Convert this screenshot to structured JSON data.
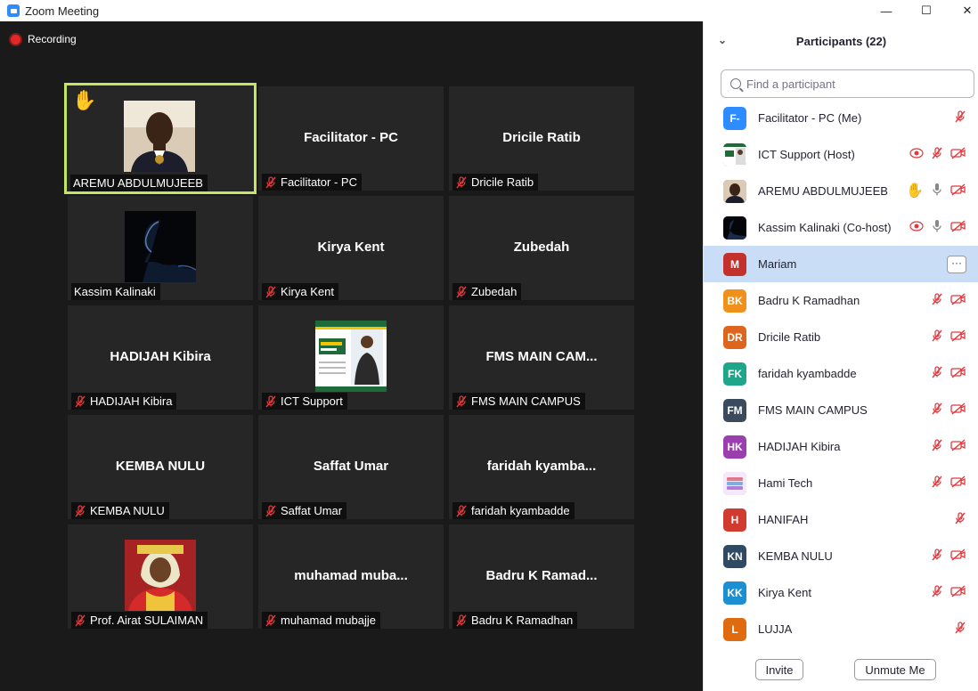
{
  "window": {
    "title": "Zoom Meeting",
    "minimize": "—",
    "maximize": "☐",
    "close": "✕"
  },
  "recording": {
    "label": "Recording"
  },
  "tiles": [
    {
      "name": "AREMU ABDULMUJEEB",
      "center": "",
      "muted": false,
      "photo": "portrait-man-suit",
      "hand": true,
      "active": true
    },
    {
      "name": "Facilitator - PC",
      "center": "Facilitator - PC",
      "muted": true
    },
    {
      "name": "Dricile Ratib",
      "center": "Dricile Ratib",
      "muted": true
    },
    {
      "name": "Kassim Kalinaki",
      "center": "",
      "muted": false,
      "photo": "silhouette-dark"
    },
    {
      "name": "Kirya Kent",
      "center": "Kirya Kent",
      "muted": true
    },
    {
      "name": "Zubedah",
      "center": "Zubedah",
      "muted": true
    },
    {
      "name": "HADIJAH Kibira",
      "center": "HADIJAH Kibira",
      "muted": true
    },
    {
      "name": "ICT Support",
      "center": "",
      "muted": true,
      "photo": "admissions-poster"
    },
    {
      "name": "FMS MAIN CAMPUS",
      "center": "FMS MAIN CAM...",
      "muted": true
    },
    {
      "name": "KEMBA NULU",
      "center": "KEMBA NULU",
      "muted": true
    },
    {
      "name": "Saffat Umar",
      "center": "Saffat Umar",
      "muted": true
    },
    {
      "name": "faridah kyambadde",
      "center": "faridah  kyamba...",
      "muted": true
    },
    {
      "name": "Prof. Airat SULAIMAN",
      "center": "",
      "muted": true,
      "photo": "portrait-academic-red"
    },
    {
      "name": "muhamad mubajje",
      "center": "muhamad  muba...",
      "muted": true
    },
    {
      "name": "Badru K Ramadhan",
      "center": "Badru  K  Ramad...",
      "muted": true
    }
  ],
  "panel": {
    "title": "Participants (22)",
    "search_placeholder": "Find a participant",
    "participants": [
      {
        "initials": "F-",
        "name": "Facilitator - PC (Me)",
        "color": "#2d8cff",
        "icons": [
          "mic-muted-icon"
        ]
      },
      {
        "initials": "",
        "name": "ICT Support (Host)",
        "color": "#3a7d3a",
        "image": "poster-thumb",
        "icons": [
          "recording-icon",
          "mic-muted-icon",
          "video-off-icon"
        ]
      },
      {
        "initials": "",
        "name": "AREMU ABDULMUJEEB",
        "color": "#555555",
        "image": "face-thumb",
        "icons": [
          "raised-hand-icon",
          "mic-on-icon",
          "video-off-icon"
        ]
      },
      {
        "initials": "",
        "name": "Kassim Kalinaki (Co-host)",
        "color": "#111111",
        "image": "silhouette-thumb",
        "icons": [
          "recording-icon",
          "mic-on-icon",
          "video-off-icon"
        ]
      },
      {
        "initials": "M",
        "name": "Mariam",
        "color": "#c4302b",
        "selected": true,
        "icons": [
          "more-button"
        ]
      },
      {
        "initials": "BK",
        "name": "Badru K Ramadhan",
        "color": "#f0911c",
        "icons": [
          "mic-muted-icon",
          "video-off-icon"
        ]
      },
      {
        "initials": "DR",
        "name": "Dricile Ratib",
        "color": "#e0651c",
        "icons": [
          "mic-muted-icon",
          "video-off-icon"
        ]
      },
      {
        "initials": "FK",
        "name": "faridah kyambadde",
        "color": "#1fa58a",
        "icons": [
          "mic-muted-icon",
          "video-off-icon"
        ]
      },
      {
        "initials": "FM",
        "name": "FMS MAIN CAMPUS",
        "color": "#3b4a5c",
        "icons": [
          "mic-muted-icon",
          "video-off-icon"
        ]
      },
      {
        "initials": "HK",
        "name": "HADIJAH Kibira",
        "color": "#9b3fb0",
        "icons": [
          "mic-muted-icon",
          "video-off-icon"
        ]
      },
      {
        "initials": "",
        "name": "Hami Tech",
        "color": "#b57bd8",
        "image": "book-thumb",
        "icons": [
          "mic-muted-icon",
          "video-off-icon"
        ]
      },
      {
        "initials": "H",
        "name": "HANIFAH",
        "color": "#d13a2e",
        "icons": [
          "mic-muted-icon"
        ]
      },
      {
        "initials": "KN",
        "name": "KEMBA NULU",
        "color": "#2f4a63",
        "icons": [
          "mic-muted-icon",
          "video-off-icon"
        ]
      },
      {
        "initials": "KK",
        "name": "Kirya Kent",
        "color": "#1b8fd1",
        "icons": [
          "mic-muted-icon",
          "video-off-icon"
        ]
      },
      {
        "initials": "L",
        "name": "LUJJA",
        "color": "#e06a0e",
        "icons": [
          "mic-muted-icon"
        ]
      }
    ],
    "invite_label": "Invite",
    "unmute_label": "Unmute Me",
    "more_label": "···"
  }
}
